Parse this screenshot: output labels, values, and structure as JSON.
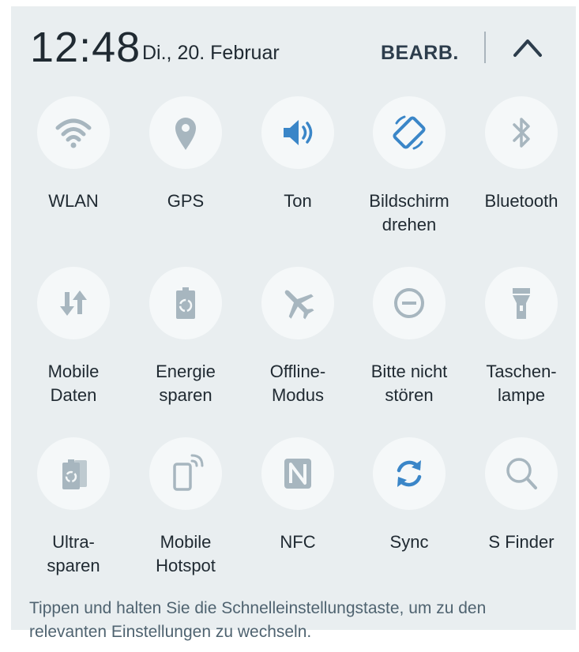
{
  "status": {
    "time": "12:48",
    "date": "Di., 20. Februar",
    "edit_label": "BEARB."
  },
  "colors": {
    "background": "#e9eef0",
    "inactive_icon": "#a7b6bf",
    "active_icon": "#3a86c8",
    "text": "#202a32"
  },
  "tiles": [
    {
      "label": "WLAN",
      "icon": "wifi-icon",
      "active": false
    },
    {
      "label": "GPS",
      "icon": "location-pin-icon",
      "active": false
    },
    {
      "label": "Ton",
      "icon": "speaker-icon",
      "active": true
    },
    {
      "label": "Bildschirm\ndrehen",
      "icon": "screen-rotation-icon",
      "active": true
    },
    {
      "label": "Bluetooth",
      "icon": "bluetooth-icon",
      "active": false
    },
    {
      "label": "Mobile\nDaten",
      "icon": "mobile-data-icon",
      "active": false
    },
    {
      "label": "Energie\nsparen",
      "icon": "battery-recycle-icon",
      "active": false
    },
    {
      "label": "Offline-\nModus",
      "icon": "airplane-icon",
      "active": false
    },
    {
      "label": "Bitte nicht\nstören",
      "icon": "do-not-disturb-icon",
      "active": false
    },
    {
      "label": "Taschen-\nlampe",
      "icon": "flashlight-icon",
      "active": false
    },
    {
      "label": "Ultra-\nsparen",
      "icon": "ultra-power-saving-icon",
      "active": false
    },
    {
      "label": "Mobile\nHotspot",
      "icon": "hotspot-icon",
      "active": false
    },
    {
      "label": "NFC",
      "icon": "nfc-icon",
      "active": false
    },
    {
      "label": "Sync",
      "icon": "sync-icon",
      "active": true
    },
    {
      "label": "S Finder",
      "icon": "search-icon",
      "active": false
    }
  ],
  "hint_text": "Tippen und halten Sie die Schnelleinstellungstaste, um zu den relevanten Einstellungen zu wechseln."
}
